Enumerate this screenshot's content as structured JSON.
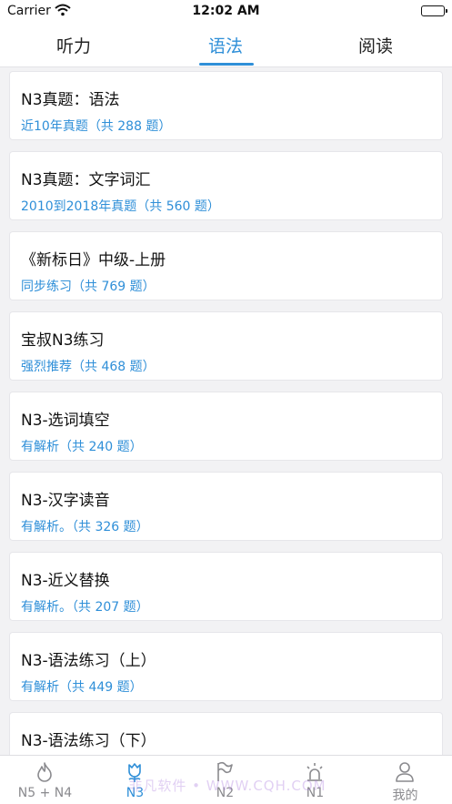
{
  "status_bar": {
    "carrier": "Carrier",
    "time": "12:02 AM"
  },
  "top_tabs": [
    {
      "label": "听力",
      "active": false
    },
    {
      "label": "语法",
      "active": true
    },
    {
      "label": "阅读",
      "active": false
    }
  ],
  "items": [
    {
      "title": "N3真题：语法",
      "subtitle": "近10年真题（共 288 题）"
    },
    {
      "title": "N3真题：文字词汇",
      "subtitle": "2010到2018年真题（共 560 题）"
    },
    {
      "title": "《新标日》中级-上册",
      "subtitle": "同步练习（共 769 题）"
    },
    {
      "title": "宝叔N3练习",
      "subtitle": "强烈推荐（共 468 题）"
    },
    {
      "title": "N3-选词填空",
      "subtitle": "有解析（共 240 题）"
    },
    {
      "title": "N3-汉字读音",
      "subtitle": "有解析。（共 326 题）"
    },
    {
      "title": "N3-近义替换",
      "subtitle": "有解析。（共 207 题）"
    },
    {
      "title": "N3-语法练习（上）",
      "subtitle": "有解析（共 449 题）"
    },
    {
      "title": "N3-语法练习（下）",
      "subtitle": ""
    }
  ],
  "bottom_nav": [
    {
      "label": "N5 + N4",
      "icon": "flame-icon",
      "active": false
    },
    {
      "label": "N3",
      "icon": "flower-icon",
      "active": true
    },
    {
      "label": "N2",
      "icon": "flag-icon",
      "active": false
    },
    {
      "label": "N1",
      "icon": "siren-icon",
      "active": false
    },
    {
      "label": "我的",
      "icon": "person-icon",
      "active": false
    }
  ],
  "watermark": "非凡软件 • WWW.CQH.COM",
  "colors": {
    "accent": "#2f8fd8",
    "inactive": "#8a8a8e",
    "background": "#f2f2f4"
  }
}
